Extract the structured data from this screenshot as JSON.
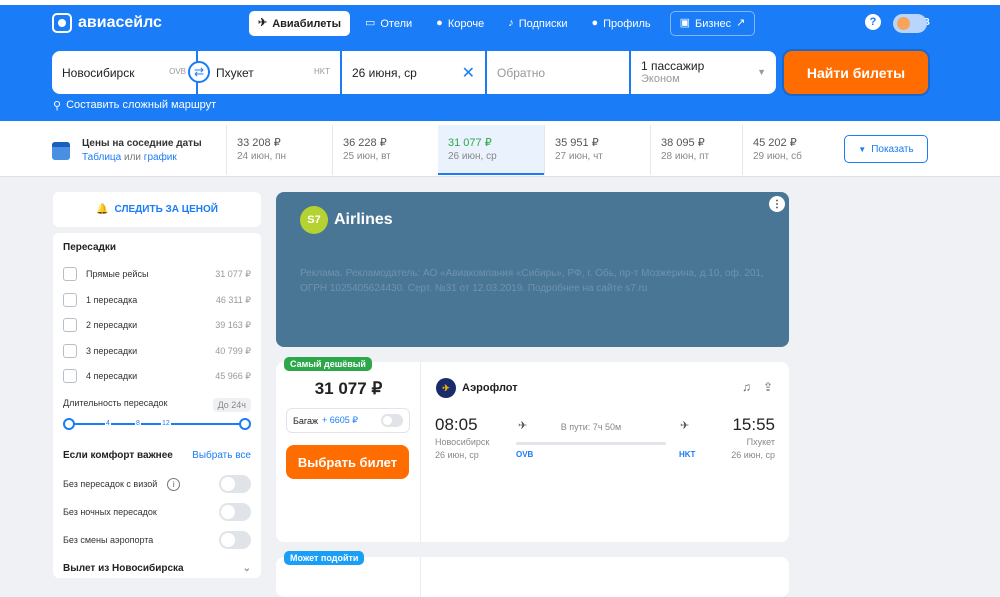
{
  "header": {
    "logo": "авиасейлс",
    "nav": [
      {
        "label": "Авиабилеты",
        "icon": "plane-icon"
      },
      {
        "label": "Отели",
        "icon": "bed-icon"
      },
      {
        "label": "Короче",
        "icon": "pin-icon"
      },
      {
        "label": "Подписки",
        "icon": "bell-icon"
      },
      {
        "label": "Профиль",
        "icon": "user-icon"
      },
      {
        "label": "Бизнес",
        "icon": "briefcase-icon"
      }
    ],
    "help": "?",
    "currency": "RUB"
  },
  "search": {
    "from": "Новосибирск",
    "from_code": "OVB",
    "to": "Пхукет",
    "to_code": "HKT",
    "date": "26 июня, ср",
    "return_placeholder": "Обратно",
    "passengers": "1 пассажир",
    "class": "Эконом",
    "find_button": "Найти билеты",
    "complex_route": "Составить сложный маршрут"
  },
  "dates": {
    "title": "Цены на соседние даты",
    "link_table": "Таблица",
    "link_or": "или",
    "link_chart": "график",
    "cells": [
      {
        "price": "33 208 ₽",
        "date": "24 июн, пн"
      },
      {
        "price": "36 228 ₽",
        "date": "25 июн, вт"
      },
      {
        "price": "31 077 ₽",
        "date": "26 июн, ср"
      },
      {
        "price": "35 951 ₽",
        "date": "27 июн, чт"
      },
      {
        "price": "38 095 ₽",
        "date": "28 июн, пт"
      },
      {
        "price": "45 202 ₽",
        "date": "29 июн, сб"
      }
    ],
    "selected_index": 2,
    "show_button": "Показать"
  },
  "sidebar": {
    "watch_price": "СЛЕДИТЬ ЗА ЦЕНОЙ",
    "transfers_title": "Пересадки",
    "transfers": [
      {
        "label": "Прямые рейсы",
        "price": "31 077 ₽"
      },
      {
        "label": "1 пересадка",
        "price": "46 311 ₽"
      },
      {
        "label": "2 пересадки",
        "price": "39 163 ₽"
      },
      {
        "label": "3 пересадки",
        "price": "40 799 ₽"
      },
      {
        "label": "4 пересадки",
        "price": "45 966 ₽"
      }
    ],
    "duration_label": "Длительность пересадок",
    "duration_badge": "До 24ч",
    "slider_marks": [
      "4",
      "8",
      "12"
    ],
    "comfort_title": "Если комфорт важнее",
    "select_all": "Выбрать все",
    "switches": [
      {
        "label": "Без пересадок с визой",
        "info": "i"
      },
      {
        "label": "Без ночных пересадок",
        "info": ""
      },
      {
        "label": "Без смены аэропорта",
        "info": ""
      }
    ],
    "departure_title": "Вылет из Новосибирска"
  },
  "ad": {
    "brand_short": "S7",
    "brand": "Airlines",
    "text": "Реклама. Рекламодатель: АО «Авиакомпания «Сибирь», РФ, г. Обь, пр-т Мозжерина, д.10, оф. 201, ОГРН 1025405624430. Серт. №31 от 12.03.2019. Подробнее на сайте s7.ru",
    "menu": "⋮"
  },
  "ticket": {
    "badge": "Самый дешёвый",
    "badge_color": "#2ca84a",
    "price": "31 077 ₽",
    "baggage": "Багаж",
    "baggage_price": "+ 6605 ₽",
    "buy_button": "Выбрать билет",
    "airline": "Аэрофлот",
    "dep_time": "08:05",
    "dep_city": "Новосибирск",
    "dep_date": "26 июн, ср",
    "dep_code": "OVB",
    "arr_time": "15:55",
    "arr_city": "Пхукет",
    "arr_date": "26 июн, ср",
    "arr_code": "HKT",
    "duration": "В пути: 7ч 50м"
  },
  "ticket2": {
    "badge": "Может подойти",
    "badge_color": "#1a9ff6"
  }
}
